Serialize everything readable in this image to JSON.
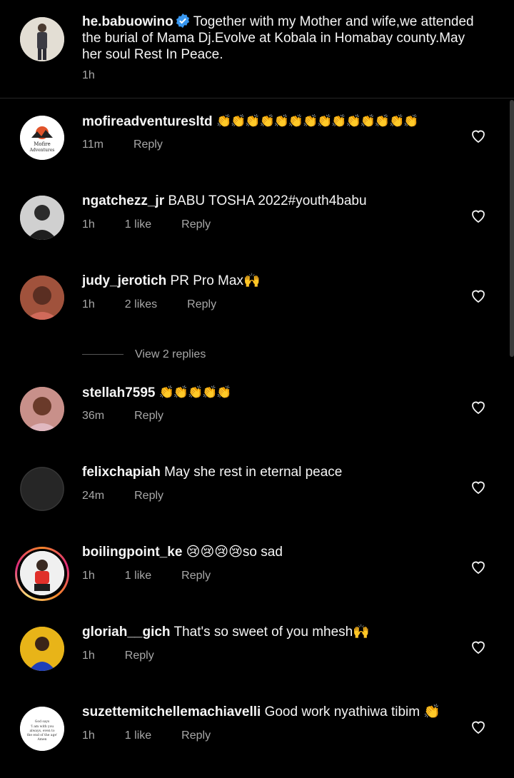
{
  "caption": {
    "username": "he.babuowino",
    "text": "Together with my Mother and wife,we attended the burial of Mama Dj.Evolve at Kobala in Homabay county.May her soul Rest In Peace.",
    "time": "1h"
  },
  "comments": [
    {
      "username": "mofireadventuresltd",
      "text": "👏👏👏👏👏👏👏👏👏👏👏👏👏👏",
      "time": "11m",
      "likes": "",
      "reply": "Reply",
      "avatar_text": "Mofire Adventures"
    },
    {
      "username": "ngatchezz_jr",
      "text": "BABU TOSHA 2022#youth4babu",
      "time": "1h",
      "likes": "1 like",
      "reply": "Reply"
    },
    {
      "username": "judy_jerotich",
      "text": "PR Pro Max🙌",
      "time": "1h",
      "likes": "2 likes",
      "reply": "Reply"
    },
    {
      "username": "stellah7595",
      "text": "👏👏👏👏👏",
      "time": "36m",
      "likes": "",
      "reply": "Reply"
    },
    {
      "username": "felixchapiah",
      "text": "May she rest in eternal peace",
      "time": "24m",
      "likes": "",
      "reply": "Reply"
    },
    {
      "username": "boilingpoint_ke",
      "text": "😢😢😢😢so sad",
      "time": "1h",
      "likes": "1 like",
      "reply": "Reply"
    },
    {
      "username": "gloriah__gich",
      "text": "That's so sweet of you mhesh🙌",
      "time": "1h",
      "likes": "",
      "reply": "Reply"
    },
    {
      "username": "suzettemitchellemachiavelli",
      "text": "Good work nyathiwa tibim 👏",
      "time": "1h",
      "likes": "1 like",
      "reply": "Reply",
      "avatar_text": "God says 'I am with you always, even to the end of the age' Amen"
    }
  ],
  "view_replies": "View 2 replies",
  "colors": {
    "background": "#000000",
    "text": "#f5f5f5",
    "secondary": "#a8a8a8",
    "verified": "#3897f0"
  }
}
